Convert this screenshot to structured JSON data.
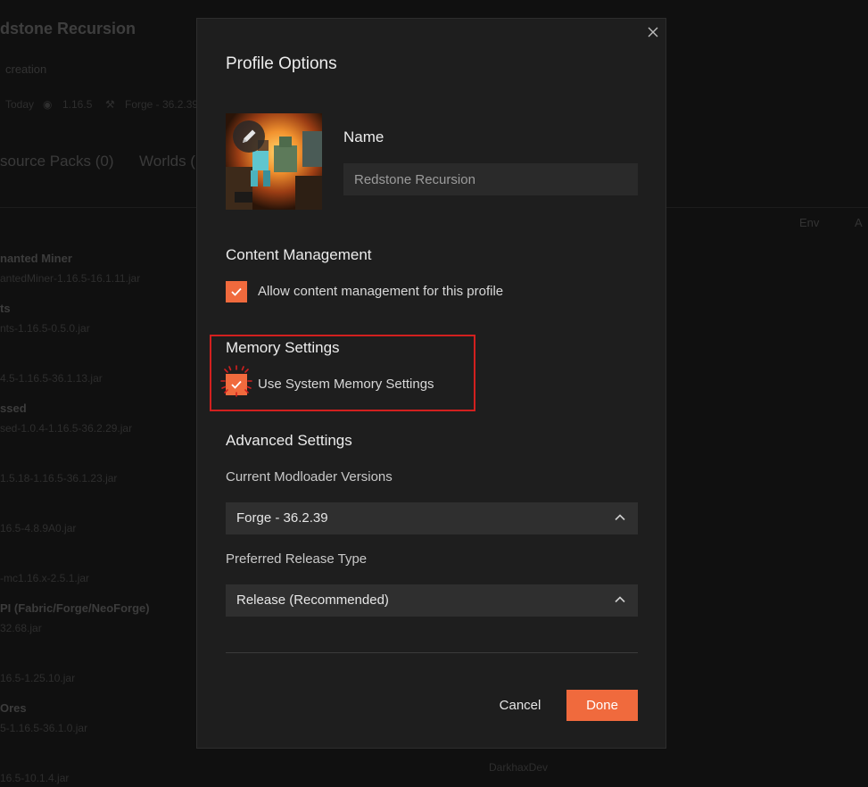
{
  "background": {
    "profile_title": "dstone Recursion",
    "profile_subtitle": "creation",
    "meta_played": "Today",
    "meta_version": "1.16.5",
    "meta_loader": "Forge - 36.2.39",
    "tab_resource_packs": "source Packs (0)",
    "tab_worlds": "Worlds (",
    "col_env": "Env",
    "col_a": "A",
    "mods": [
      {
        "name": "nanted Miner",
        "file": "antedMiner-1.16.5-16.1.11.jar"
      },
      {
        "name": "ts",
        "file": "nts-1.16.5-0.5.0.jar"
      },
      {
        "name": "",
        "file": "4.5-1.16.5-36.1.13.jar"
      },
      {
        "name": "ssed",
        "file": "sed-1.0.4-1.16.5-36.2.29.jar"
      },
      {
        "name": "",
        "file": "1.5.18-1.16.5-36.1.23.jar"
      },
      {
        "name": "",
        "file": "16.5-4.8.9A0.jar"
      },
      {
        "name": "",
        "file": "-mc1.16.x-2.5.1.jar"
      },
      {
        "name": "PI (Fabric/Forge/NeoForge)",
        "file": "32.68.jar"
      },
      {
        "name": "",
        "file": "16.5-1.25.10.jar"
      },
      {
        "name": "Ores",
        "file": "5-1.16.5-36.1.0.jar"
      },
      {
        "name": "",
        "file": "16.5-10.1.4.jar"
      }
    ],
    "author": "DarkhaxDev"
  },
  "dialog": {
    "title": "Profile Options",
    "close_icon": "close-icon",
    "avatar_icon": "edit-pencil-icon",
    "name_label": "Name",
    "name_value": "Redstone Recursion",
    "content_management": {
      "title": "Content Management",
      "checkbox_label": "Allow content management for this profile",
      "checked": true
    },
    "memory_settings": {
      "title": "Memory Settings",
      "checkbox_label": "Use System Memory Settings",
      "checked": true
    },
    "advanced_settings": {
      "title": "Advanced Settings",
      "modloader_label": "Current Modloader Versions",
      "modloader_value": "Forge - 36.2.39",
      "release_label": "Preferred Release Type",
      "release_value": "Release (Recommended)"
    },
    "cancel_label": "Cancel",
    "done_label": "Done"
  },
  "colors": {
    "accent": "#f06a3d",
    "highlight_box": "#d2201f",
    "dialog_bg": "#1e1e1e",
    "input_bg": "#2a2a2a",
    "select_bg": "#2f2f2f"
  }
}
